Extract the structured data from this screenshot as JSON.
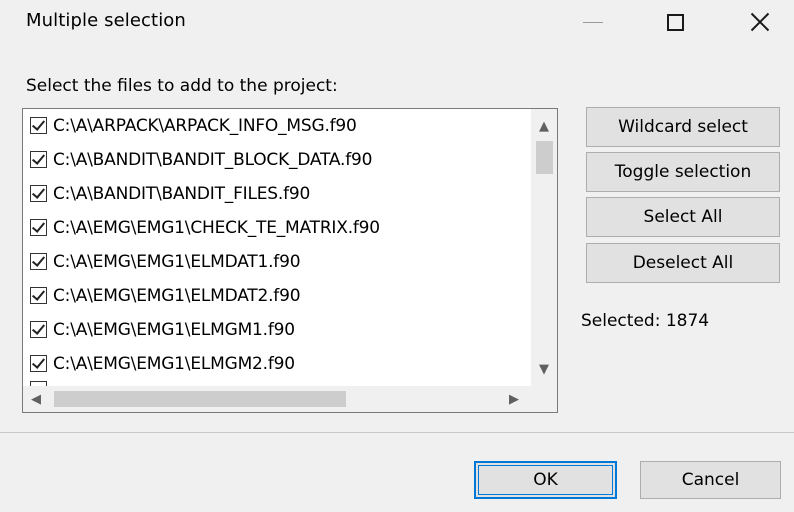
{
  "window": {
    "title": "Multiple selection",
    "icons": {
      "minimize": "minimize-icon",
      "maximize": "maximize-icon",
      "close": "close-icon"
    }
  },
  "prompt": "Select the files to add to the project:",
  "files": [
    {
      "path": "C:\\A\\ARPACK\\ARPACK_INFO_MSG.f90",
      "checked": true
    },
    {
      "path": "C:\\A\\BANDIT\\BANDIT_BLOCK_DATA.f90",
      "checked": true
    },
    {
      "path": "C:\\A\\BANDIT\\BANDIT_FILES.f90",
      "checked": true
    },
    {
      "path": "C:\\A\\EMG\\EMG1\\CHECK_TE_MATRIX.f90",
      "checked": true
    },
    {
      "path": "C:\\A\\EMG\\EMG1\\ELMDAT1.f90",
      "checked": true
    },
    {
      "path": "C:\\A\\EMG\\EMG1\\ELMDAT2.f90",
      "checked": true
    },
    {
      "path": "C:\\A\\EMG\\EMG1\\ELMGM1.f90",
      "checked": true
    },
    {
      "path": "C:\\A\\EMG\\EMG1\\ELMGM2.f90",
      "checked": true
    }
  ],
  "scroll_icons": {
    "up": "▲",
    "down": "▼",
    "left": "◀",
    "right": "▶"
  },
  "buttons": {
    "wildcard": "Wildcard select",
    "toggle": "Toggle selection",
    "select_all": "Select All",
    "deselect_all": "Deselect All",
    "ok": "OK",
    "cancel": "Cancel"
  },
  "status": {
    "selected": "Selected: 1874"
  },
  "colors": {
    "focus": "#0078d7",
    "button_face": "#e1e1e1",
    "window_bg": "#f0f0f0"
  }
}
